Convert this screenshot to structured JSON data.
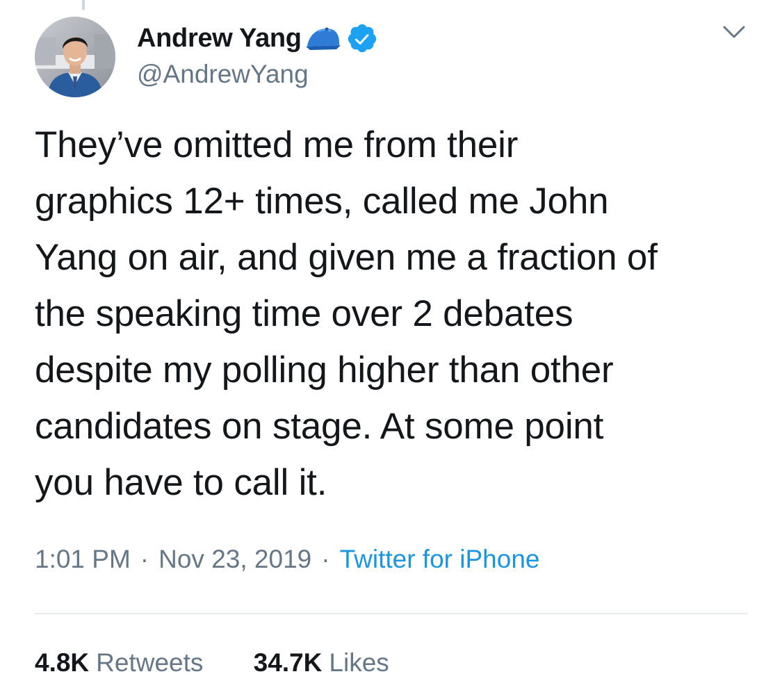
{
  "colors": {
    "text": "#14171a",
    "secondary": "#657786",
    "link": "#1b95e0",
    "verified": "#1da1f2",
    "divider": "#e6ecf0"
  },
  "author": {
    "name": "Andrew Yang",
    "handle": "@AndrewYang",
    "name_emoji_icon": "blue-cap-icon",
    "verified_icon": "verified-badge-icon",
    "avatar_icon": "profile-photo"
  },
  "menu_icon": "chevron-down-icon",
  "tweet": {
    "text": "They’ve omitted me from their\ngraphics 12+ times, called me John\nYang on air, and given me a fraction of\nthe speaking time over 2 debates\ndespite my polling higher than other\ncandidates on stage. At some point\nyou have to call it.",
    "time": "1:01 PM",
    "date": "Nov 23, 2019",
    "separator": "·",
    "source": "Twitter for iPhone"
  },
  "stats": {
    "retweets_count": "4.8K",
    "retweets_label": "Retweets",
    "likes_count": "34.7K",
    "likes_label": "Likes"
  }
}
